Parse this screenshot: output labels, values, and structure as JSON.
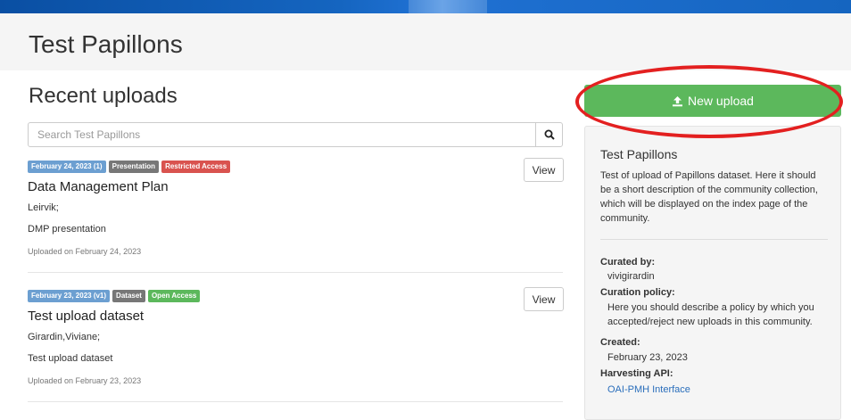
{
  "community": {
    "title": "Test Papillons"
  },
  "main": {
    "section_title": "Recent uploads",
    "search": {
      "placeholder": "Search Test Papillons"
    },
    "records": [
      {
        "badges": [
          {
            "text": "February 24, 2023 (1)",
            "kind": "date"
          },
          {
            "text": "Presentation",
            "kind": "type"
          },
          {
            "text": "Restricted Access",
            "kind": "restricted"
          }
        ],
        "view_label": "View",
        "title": "Data Management Plan",
        "authors": "Leirvik;",
        "description": "DMP presentation",
        "uploaded": "Uploaded on February 24, 2023"
      },
      {
        "badges": [
          {
            "text": "February 23, 2023 (v1)",
            "kind": "date"
          },
          {
            "text": "Dataset",
            "kind": "type"
          },
          {
            "text": "Open Access",
            "kind": "open"
          }
        ],
        "view_label": "View",
        "title": "Test upload dataset",
        "authors": "Girardin,Viviane;",
        "description": "Test upload dataset",
        "uploaded": "Uploaded on February 23, 2023"
      }
    ]
  },
  "sidebar": {
    "new_upload_label": "New upload",
    "panel": {
      "title": "Test Papillons",
      "description": "Test of upload of Papillons dataset. Here it should be a  short description of the community collection, which will be displayed on the index page of the community.",
      "curated_by_label": "Curated by:",
      "curated_by_value": "vivigirardin",
      "curation_policy_label": "Curation policy:",
      "curation_policy_value": "Here you should describe a policy by which you accepted/reject new uploads in this community.",
      "created_label": "Created:",
      "created_value": "February 23, 2023",
      "harvesting_label": "Harvesting API:",
      "harvesting_value": "OAI-PMH Interface"
    }
  },
  "colors": {
    "primary_green": "#5cb85c",
    "restricted_red": "#d9534f",
    "date_blue": "#6c9fd1",
    "annotation_red": "#e32020",
    "link_blue": "#2a6ebb"
  },
  "icons": {
    "search": "search-icon",
    "upload": "upload-icon"
  }
}
